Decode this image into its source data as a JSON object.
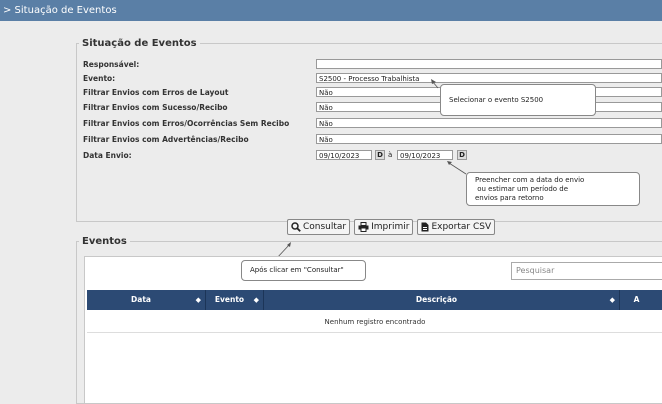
{
  "window": {
    "title": "> Situação de Eventos"
  },
  "section_situacao": {
    "legend": "Situação de Eventos",
    "fields": [
      {
        "label": "Responsável:",
        "value": ""
      },
      {
        "label": "Evento:",
        "value": "S2500 - Processo Trabalhista"
      },
      {
        "label": "Filtrar Envios com Erros de Layout",
        "value": "Não"
      },
      {
        "label": "Filtrar Envios com Sucesso/Recibo",
        "value": "Não"
      },
      {
        "label": "Filtrar Envios com Erros/Ocorrências Sem Recibo",
        "value": "Não"
      },
      {
        "label": "Filtrar Envios com Advertências/Recibo",
        "value": "Não"
      }
    ],
    "data_envio": {
      "label": "Data Envio:",
      "from": "09/10/2023",
      "to": "09/10/2023",
      "button_label": "D",
      "separator": "à"
    }
  },
  "callouts": {
    "evento": "Selecionar o evento S2500",
    "data": [
      "Preencher com a data do envio",
      " ou estimar um período de",
      "envios para retorno"
    ],
    "consultar": "Após clicar em \"Consultar\""
  },
  "actions": {
    "consultar": "Consultar",
    "imprimir": "Imprimir",
    "exportar": "Exportar CSV"
  },
  "icons": [
    "search-icon",
    "printer-icon",
    "file-csv-icon",
    "sort-icon"
  ],
  "section_eventos": {
    "legend": "Eventos",
    "search_placeholder": "Pesquisar",
    "columns": [
      "Data",
      "Evento",
      "Descrição",
      "A"
    ],
    "empty_message": "Nenhum registro encontrado"
  },
  "colors": {
    "titlebar": "#5a7fa6",
    "table_header": "#2c4a74"
  }
}
